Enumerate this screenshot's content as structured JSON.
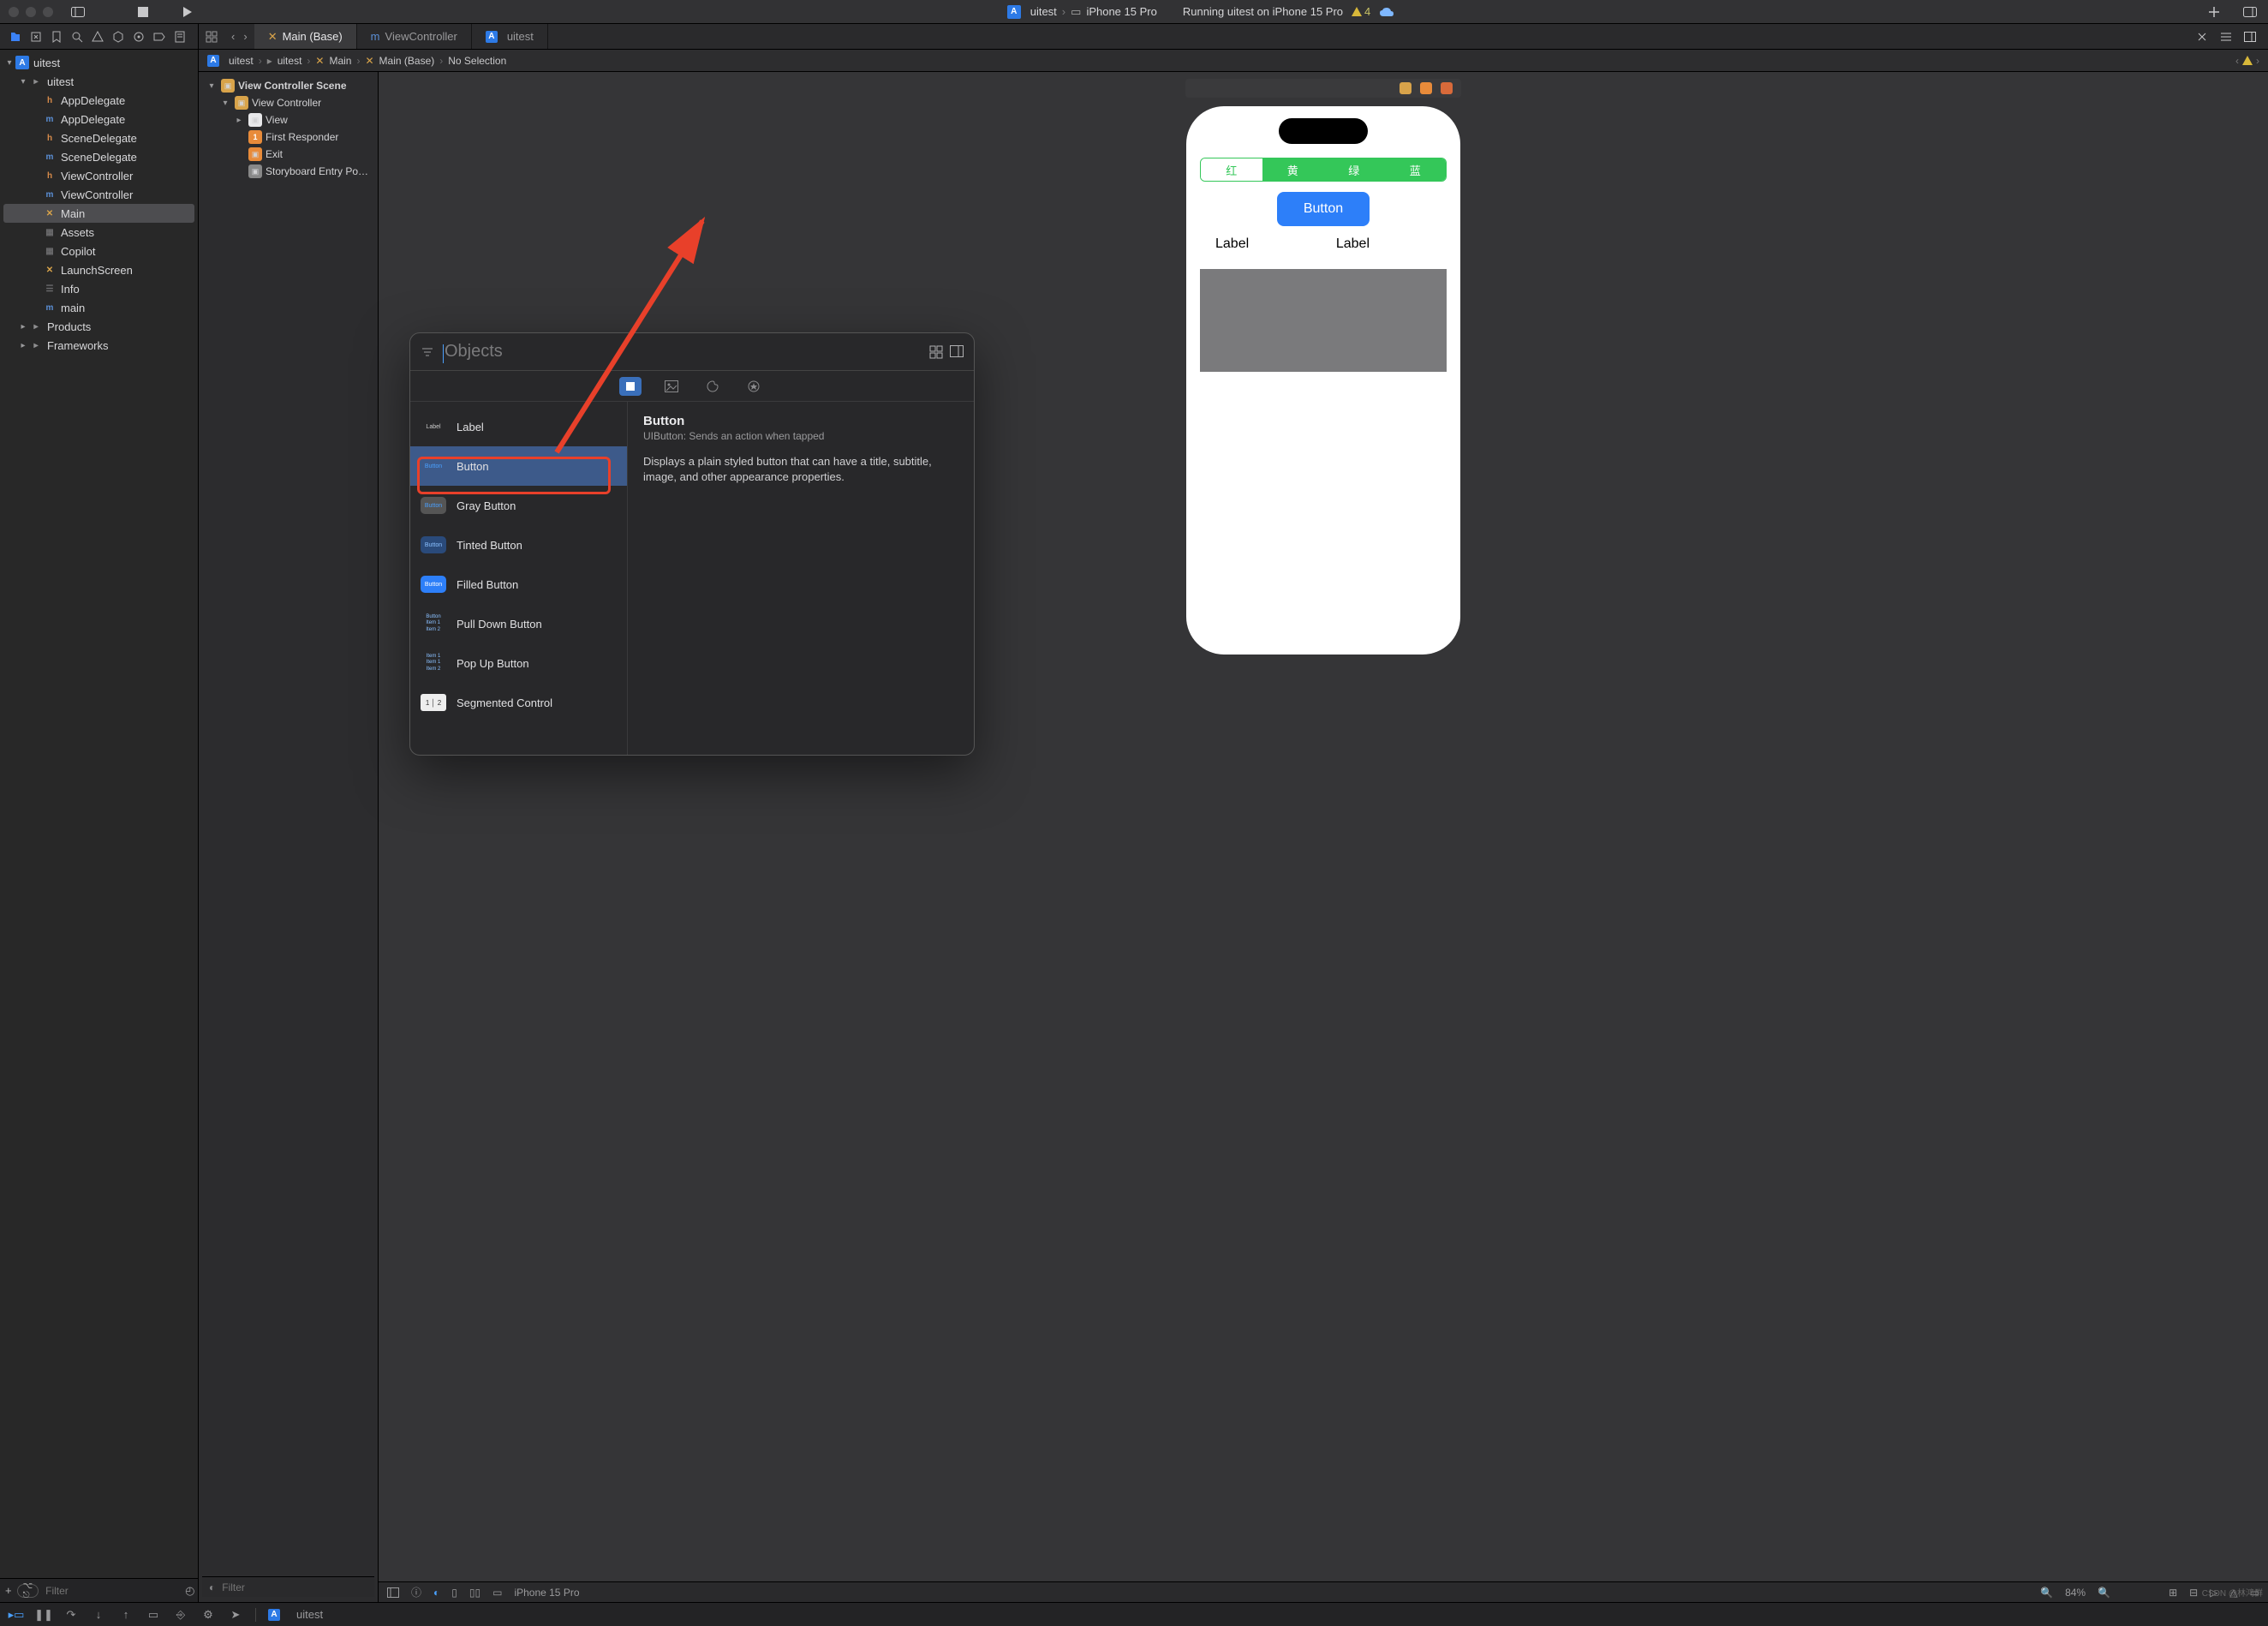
{
  "titlebar": {
    "project": "uitest",
    "scheme": "uitest",
    "device": "iPhone 15 Pro",
    "status": "Running uitest on iPhone 15 Pro",
    "warnings": "4"
  },
  "tabs": [
    {
      "label": "Main (Base)",
      "active": true,
      "icon": "ib"
    },
    {
      "label": "ViewController",
      "active": false,
      "icon": "m"
    },
    {
      "label": "uitest",
      "active": false,
      "icon": "app"
    }
  ],
  "navigator": {
    "root": "uitest",
    "group": "uitest",
    "files": [
      {
        "name": "AppDelegate",
        "kind": "h"
      },
      {
        "name": "AppDelegate",
        "kind": "m"
      },
      {
        "name": "SceneDelegate",
        "kind": "h"
      },
      {
        "name": "SceneDelegate",
        "kind": "m"
      },
      {
        "name": "ViewController",
        "kind": "h"
      },
      {
        "name": "ViewController",
        "kind": "m"
      },
      {
        "name": "Main",
        "kind": "ib",
        "selected": true
      },
      {
        "name": "Assets",
        "kind": "asset"
      },
      {
        "name": "Copilot",
        "kind": "asset"
      },
      {
        "name": "LaunchScreen",
        "kind": "ib"
      },
      {
        "name": "Info",
        "kind": "plist"
      },
      {
        "name": "main",
        "kind": "m"
      }
    ],
    "folders": [
      "Products",
      "Frameworks"
    ],
    "filter_placeholder": "Filter"
  },
  "breadcrumb": [
    "uitest",
    "uitest",
    "Main",
    "Main (Base)",
    "No Selection"
  ],
  "outline": {
    "scene": "View Controller Scene",
    "items": [
      {
        "label": "View Controller",
        "icon": "yellow",
        "indent": 1,
        "disclosure": "open"
      },
      {
        "label": "View",
        "icon": "white",
        "indent": 2,
        "disclosure": "closed"
      },
      {
        "label": "First Responder",
        "icon": "num",
        "indent": 2
      },
      {
        "label": "Exit",
        "icon": "orange",
        "indent": 2
      },
      {
        "label": "Storyboard Entry Po…",
        "icon": "gray",
        "indent": 2
      }
    ],
    "filter_placeholder": "Filter"
  },
  "canvas": {
    "segments": [
      "红",
      "黄",
      "绿",
      "蓝"
    ],
    "button": "Button",
    "label_left": "Label",
    "label_right": "Label",
    "device": "iPhone 15 Pro",
    "zoom": "84%"
  },
  "library": {
    "search_placeholder": "Objects",
    "items": [
      {
        "label": "Label",
        "thumb": "Label",
        "thumb_style": "plain"
      },
      {
        "label": "Button",
        "thumb": "Button",
        "thumb_style": "plain-blue",
        "selected": true
      },
      {
        "label": "Gray Button",
        "thumb": "Button",
        "thumb_style": "gray"
      },
      {
        "label": "Tinted Button",
        "thumb": "Button",
        "thumb_style": "tinted"
      },
      {
        "label": "Filled Button",
        "thumb": "Button",
        "thumb_style": "filled"
      },
      {
        "label": "Pull Down Button",
        "thumb": "Button",
        "thumb_style": "menu"
      },
      {
        "label": "Pop Up Button",
        "thumb": "Item 1",
        "thumb_style": "menu"
      },
      {
        "label": "Segmented Control",
        "thumb": "1 2",
        "thumb_style": "seg"
      }
    ],
    "detail": {
      "title": "Button",
      "subtitle": "UIButton: Sends an action when tapped",
      "description": "Displays a plain styled button that can have a title, subtitle, image, and other appearance properties."
    }
  },
  "debug": {
    "target": "uitest"
  },
  "watermark": "CSDN @林鸿群"
}
